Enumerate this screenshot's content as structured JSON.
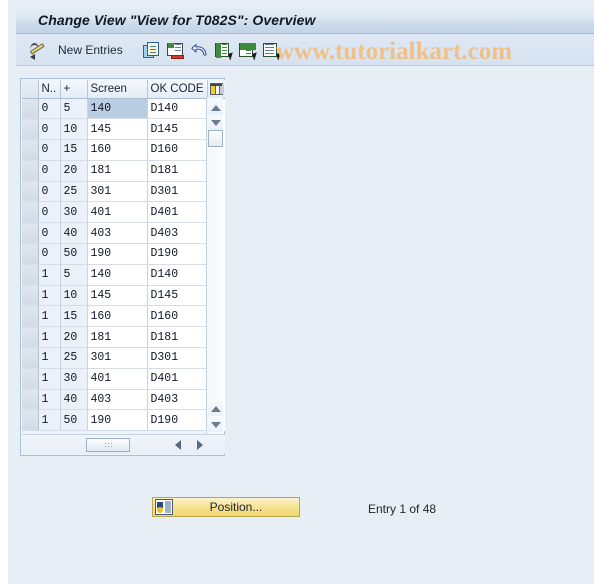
{
  "window": {
    "title": "Change View \"View for T082S\": Overview"
  },
  "watermark": "www.tutorialkart.com",
  "toolbar": {
    "edit_icon": "pencil-icon",
    "new_entries_label": "New Entries",
    "buttons": [
      {
        "name": "copy-button",
        "icon": "copy-icon"
      },
      {
        "name": "delete-button",
        "icon": "delete-row-icon"
      },
      {
        "name": "undo-button",
        "icon": "undo-icon"
      },
      {
        "name": "select-all-button",
        "icon": "select-all-icon"
      },
      {
        "name": "deselect-all-button",
        "icon": "deselect-all-icon"
      },
      {
        "name": "details-button",
        "icon": "details-icon"
      }
    ]
  },
  "table": {
    "columns": [
      {
        "key": "select",
        "label": ""
      },
      {
        "key": "n",
        "label": "N.."
      },
      {
        "key": "plus",
        "label": "+"
      },
      {
        "key": "screen",
        "label": "Screen"
      },
      {
        "key": "okcode",
        "label": "OK CODE"
      }
    ],
    "settings_icon": "table-settings-icon",
    "selected_cell": {
      "row": 0,
      "column": "screen",
      "value": "140"
    },
    "rows": [
      {
        "n": "0",
        "plus": "5",
        "screen": "140",
        "okcode": "D140"
      },
      {
        "n": "0",
        "plus": "10",
        "screen": "145",
        "okcode": "D145"
      },
      {
        "n": "0",
        "plus": "15",
        "screen": "160",
        "okcode": "D160"
      },
      {
        "n": "0",
        "plus": "20",
        "screen": "181",
        "okcode": "D181"
      },
      {
        "n": "0",
        "plus": "25",
        "screen": "301",
        "okcode": "D301"
      },
      {
        "n": "0",
        "plus": "30",
        "screen": "401",
        "okcode": "D401"
      },
      {
        "n": "0",
        "plus": "40",
        "screen": "403",
        "okcode": "D403"
      },
      {
        "n": "0",
        "plus": "50",
        "screen": "190",
        "okcode": "D190"
      },
      {
        "n": "1",
        "plus": "5",
        "screen": "140",
        "okcode": "D140"
      },
      {
        "n": "1",
        "plus": "10",
        "screen": "145",
        "okcode": "D145"
      },
      {
        "n": "1",
        "plus": "15",
        "screen": "160",
        "okcode": "D160"
      },
      {
        "n": "1",
        "plus": "20",
        "screen": "181",
        "okcode": "D181"
      },
      {
        "n": "1",
        "plus": "25",
        "screen": "301",
        "okcode": "D301"
      },
      {
        "n": "1",
        "plus": "30",
        "screen": "401",
        "okcode": "D401"
      },
      {
        "n": "1",
        "plus": "40",
        "screen": "403",
        "okcode": "D403"
      },
      {
        "n": "1",
        "plus": "50",
        "screen": "190",
        "okcode": "D190"
      }
    ]
  },
  "footer": {
    "position_button_label": "Position...",
    "position_button_icon": "position-icon",
    "entry_status": "Entry 1 of 48"
  }
}
